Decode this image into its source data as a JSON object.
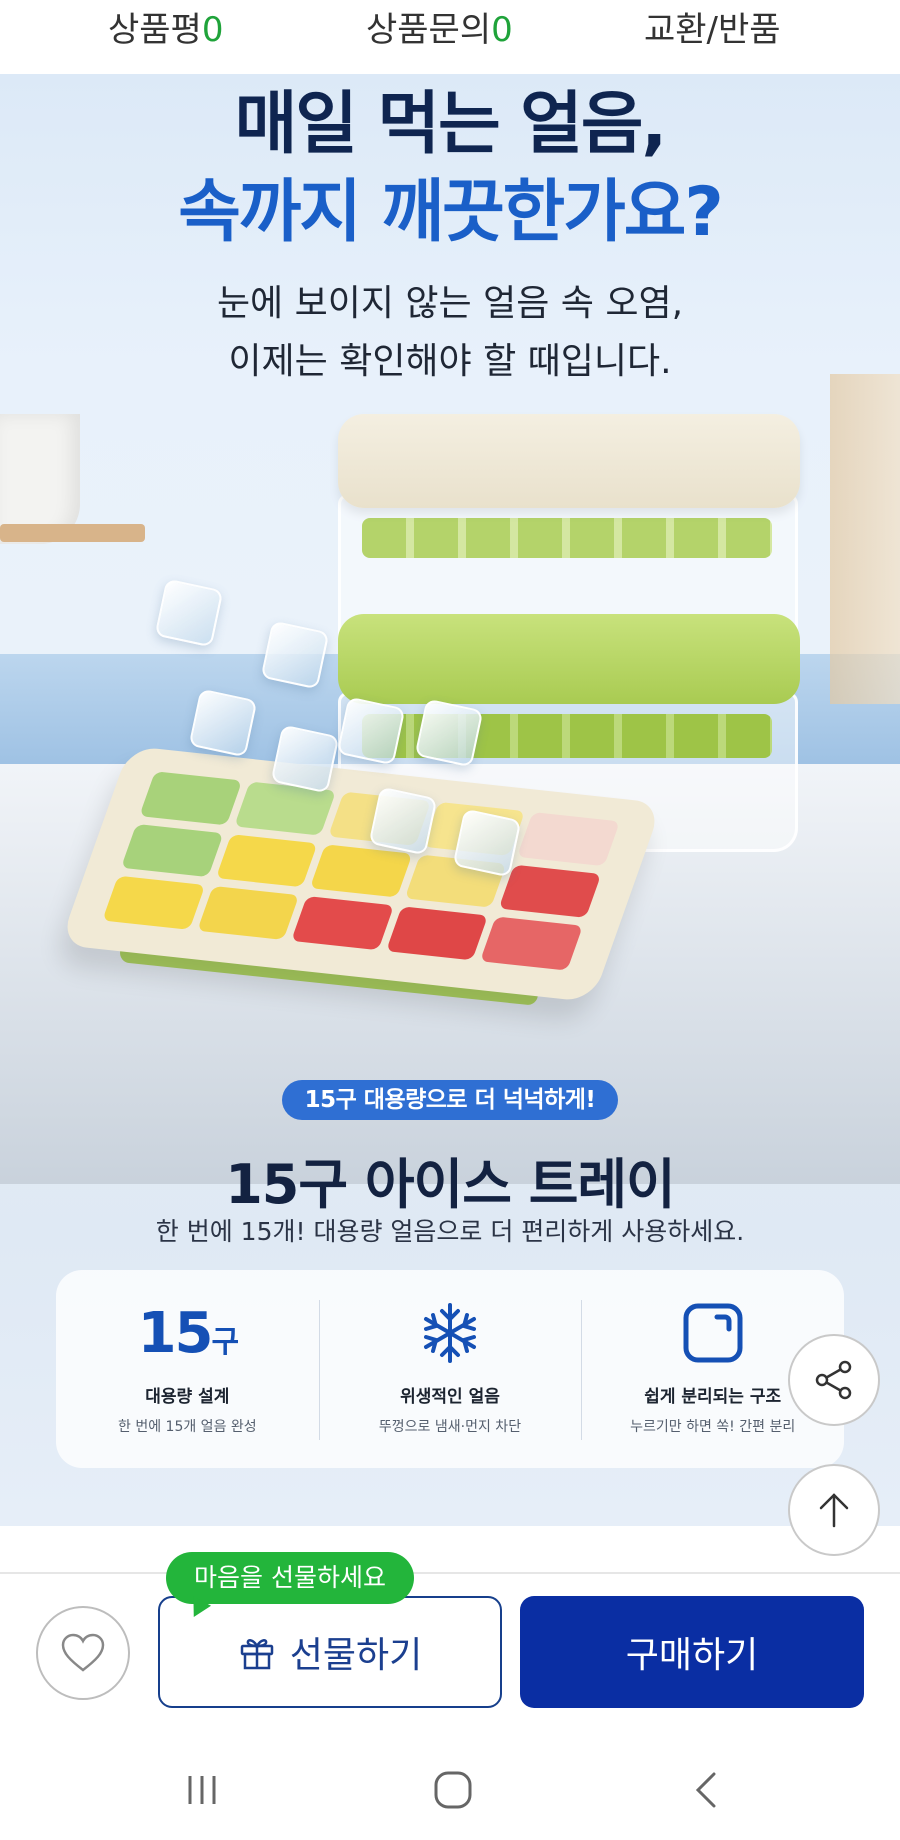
{
  "tabs": [
    {
      "label": "상품평",
      "count": "0"
    },
    {
      "label": "상품문의",
      "count": "0"
    },
    {
      "label": "교환/반품"
    }
  ],
  "hero": {
    "headline_line1": "매일 먹는 얼음,",
    "headline_line2": "속까지 깨끗한가요?",
    "sub_line1": "눈에 보이지 않는 얼음 속 오염,",
    "sub_line2": "이제는 확인해야 할 때입니다."
  },
  "product": {
    "badge": "15구 대용량으로 더 넉넉하게!",
    "title": "15구 아이스 트레이",
    "description": "한 번에 15개! 대용량 얼음으로 더 편리하게 사용하세요."
  },
  "features": [
    {
      "icon": "15-compartment-icon",
      "big": "15",
      "unit": "구",
      "title": "대용량 설계",
      "sub": "한 번에 15개 얼음 완성"
    },
    {
      "icon": "snowflake-icon",
      "title": "위생적인 얼음",
      "sub": "뚜껑으로 냄새·먼지 차단"
    },
    {
      "icon": "square-separate-icon",
      "title": "쉽게 분리되는 구조",
      "sub": "누르기만 하면 쏙! 간편 분리"
    }
  ],
  "floating": {
    "share_icon": "share-icon",
    "top_icon": "arrow-up-icon"
  },
  "purchase_bar": {
    "wish_icon": "heart-icon",
    "gift_bubble": "마음을 선물하세요",
    "gift_label": "선물하기",
    "buy_label": "구매하기"
  },
  "colors": {
    "accent_blue": "#0a2ea3",
    "headline_blue": "#1a5fc8",
    "badge_blue": "#2f6fd3",
    "count_green": "#1fa33a",
    "bubble_green": "#23b53b"
  },
  "system_nav": [
    "recent-apps-icon",
    "home-icon",
    "back-icon"
  ]
}
